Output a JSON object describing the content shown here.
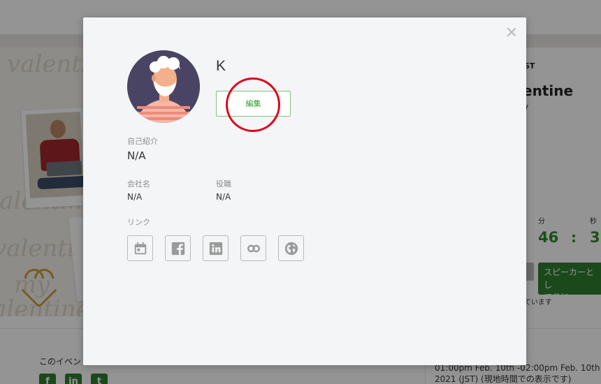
{
  "background": {
    "hero_script_words": [
      "valentine",
      "my",
      "valentine",
      "valentine",
      "my",
      "valentine"
    ],
    "event": {
      "date_fragment": "ST",
      "title_fragment": "entine",
      "title_tail": "y",
      "minutes_label": "分",
      "seconds_label": "秒",
      "minutes_value": "46",
      "colon": ":",
      "seconds_value": "3",
      "speaker_button_label": "スピーカーとし\nて参加",
      "note_fragment": "れています"
    },
    "footer": {
      "share_label": "このイベン",
      "social": [
        {
          "name": "facebook",
          "glyph": "f"
        },
        {
          "name": "linkedin",
          "glyph": "in"
        },
        {
          "name": "twitter",
          "glyph": "t"
        }
      ],
      "datetime_line1": "01:00pm Feb. 10th -02:00pm Feb. 10th",
      "datetime_line2": "2021 (JST) (現地時間での表示です)"
    }
  },
  "modal": {
    "user_name": "K",
    "edit_label": "編集",
    "bio_label": "自己紹介",
    "bio_value": "N/A",
    "company_label": "会社名",
    "company_value": "N/A",
    "role_label": "役職",
    "role_value": "N/A",
    "links_label": "リンク",
    "link_icons": [
      "calendar-icon",
      "facebook-icon",
      "linkedin-icon",
      "link-chain-icon",
      "globe-icon"
    ]
  },
  "colors": {
    "accent_green": "#2f9e2f",
    "annotation_red": "#e0001c",
    "avatar_bg": "#4a4464"
  }
}
